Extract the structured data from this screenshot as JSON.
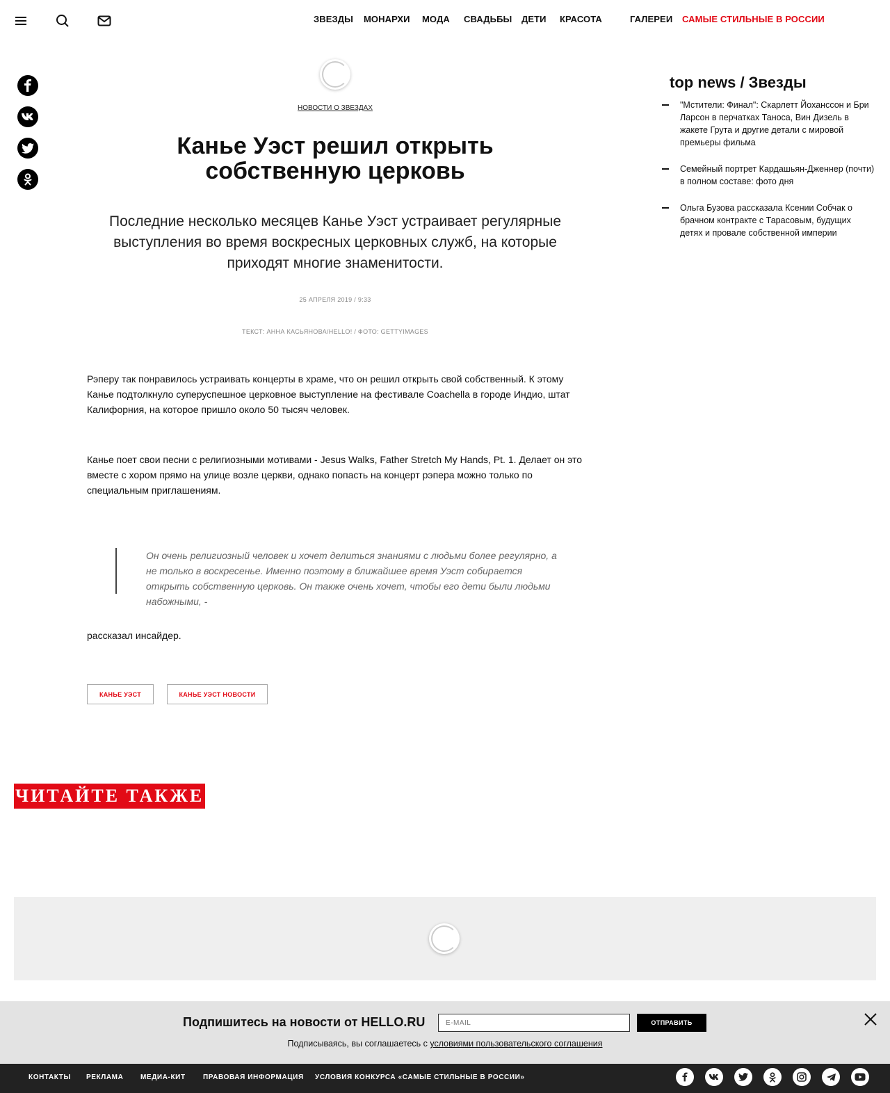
{
  "header": {
    "nav": [
      {
        "label": "ЗВЕЗДЫ"
      },
      {
        "label": "МОНАРХИ"
      },
      {
        "label": "МОДА"
      },
      {
        "label": "СВАДЬБЫ"
      },
      {
        "label": "ДЕТИ"
      },
      {
        "label": "КРАСОТА"
      },
      {
        "label": "ГАЛЕРЕИ"
      },
      {
        "label": "САМЫЕ СТИЛЬНЫЕ В РОССИИ"
      }
    ]
  },
  "article": {
    "rubric": "НОВОСТИ О ЗВЕЗДАХ",
    "title": "Канье Уэст решил открыть собственную церковь",
    "lead": "Последние несколько месяцев Канье Уэст устраивает регулярные выступления во время воскресных церковных служб, на которые приходят многие знаменитости.",
    "date": "25 АПРЕЛЯ 2019 / 9:33",
    "credits": "ТЕКСТ: АННА КАСЬЯНОВА/HELLO! / ФОТО: GETTYIMAGES",
    "paragraphs": [
      "Рэперу так понравилось устраивать концерты в храме, что он решил открыть свой собственный. К этому Канье подтолкнуло суперуспешное церковное выступление на фестивале Coachella в городе Индио, штат Калифорния, на которое пришло около 50 тысяч человек.",
      "Канье поет свои песни с религиозными мотивами - Jesus Walks, Father Stretch My Hands, Pt. 1. Делает он это вместе с хором прямо на улице возле церкви, однако попасть на концерт рэпера можно только по специальным приглашениям.",
      "рассказал инсайдер."
    ],
    "quote": "Он очень религиозный человек и хочет делиться знаниями с людьми более регулярно, а не только в воскресенье. Именно поэтому в ближайшее время Уэст собирается открыть собственную церковь. Он также очень хочет, чтобы его дети были людьми набожными, -",
    "tags": [
      "КАНЬЕ УЭСТ",
      "КАНЬЕ УЭСТ НОВОСТИ"
    ]
  },
  "sidebar": {
    "heading": "top news / Звезды",
    "items": [
      "\"Мстители: Финал\": Скарлетт Йоханссон и Бри Ларсон в перчатках Таноса, Вин Дизель в жакете Грута и другие детали с мировой премьеры фильма",
      "Семейный портрет Кардашьян-Дженнер (почти) в полном составе: фото дня",
      "Ольга Бузова рассказала Ксении Собчак о брачном контракте с Тарасовым, будущих детях и провале собственной империи"
    ]
  },
  "read_also": "ЧИТАЙТЕ ТАКЖЕ",
  "subscribe": {
    "title": "Подпишитесь на новости от HELLO.RU",
    "placeholder": "E-MAIL",
    "button": "ОТПРАВИТЬ",
    "note_prefix": "Подписываясь, вы соглашаетесь с ",
    "note_link": "условиями пользовательского соглашения"
  },
  "footer": {
    "links": [
      "КОНТАКТЫ",
      "РЕКЛАМА",
      "МЕДИА-КИТ",
      "ПРАВОВАЯ ИНФОРМАЦИЯ",
      "УСЛОВИЯ КОНКУРСА «САМЫЕ СТИЛЬНЫЕ В РОССИИ»"
    ]
  },
  "colors": {
    "accent": "#e20a16",
    "footer_bg": "#222222",
    "subscribe_bg": "#e3e3e3"
  },
  "icons": {
    "header": [
      "menu-icon",
      "search-icon",
      "mail-icon"
    ],
    "social_left": [
      "facebook-icon",
      "vk-icon",
      "twitter-icon",
      "odnoklassniki-icon"
    ],
    "social_footer": [
      "facebook-icon",
      "vk-icon",
      "twitter-icon",
      "odnoklassniki-icon",
      "instagram-icon",
      "telegram-icon",
      "youtube-icon"
    ]
  }
}
